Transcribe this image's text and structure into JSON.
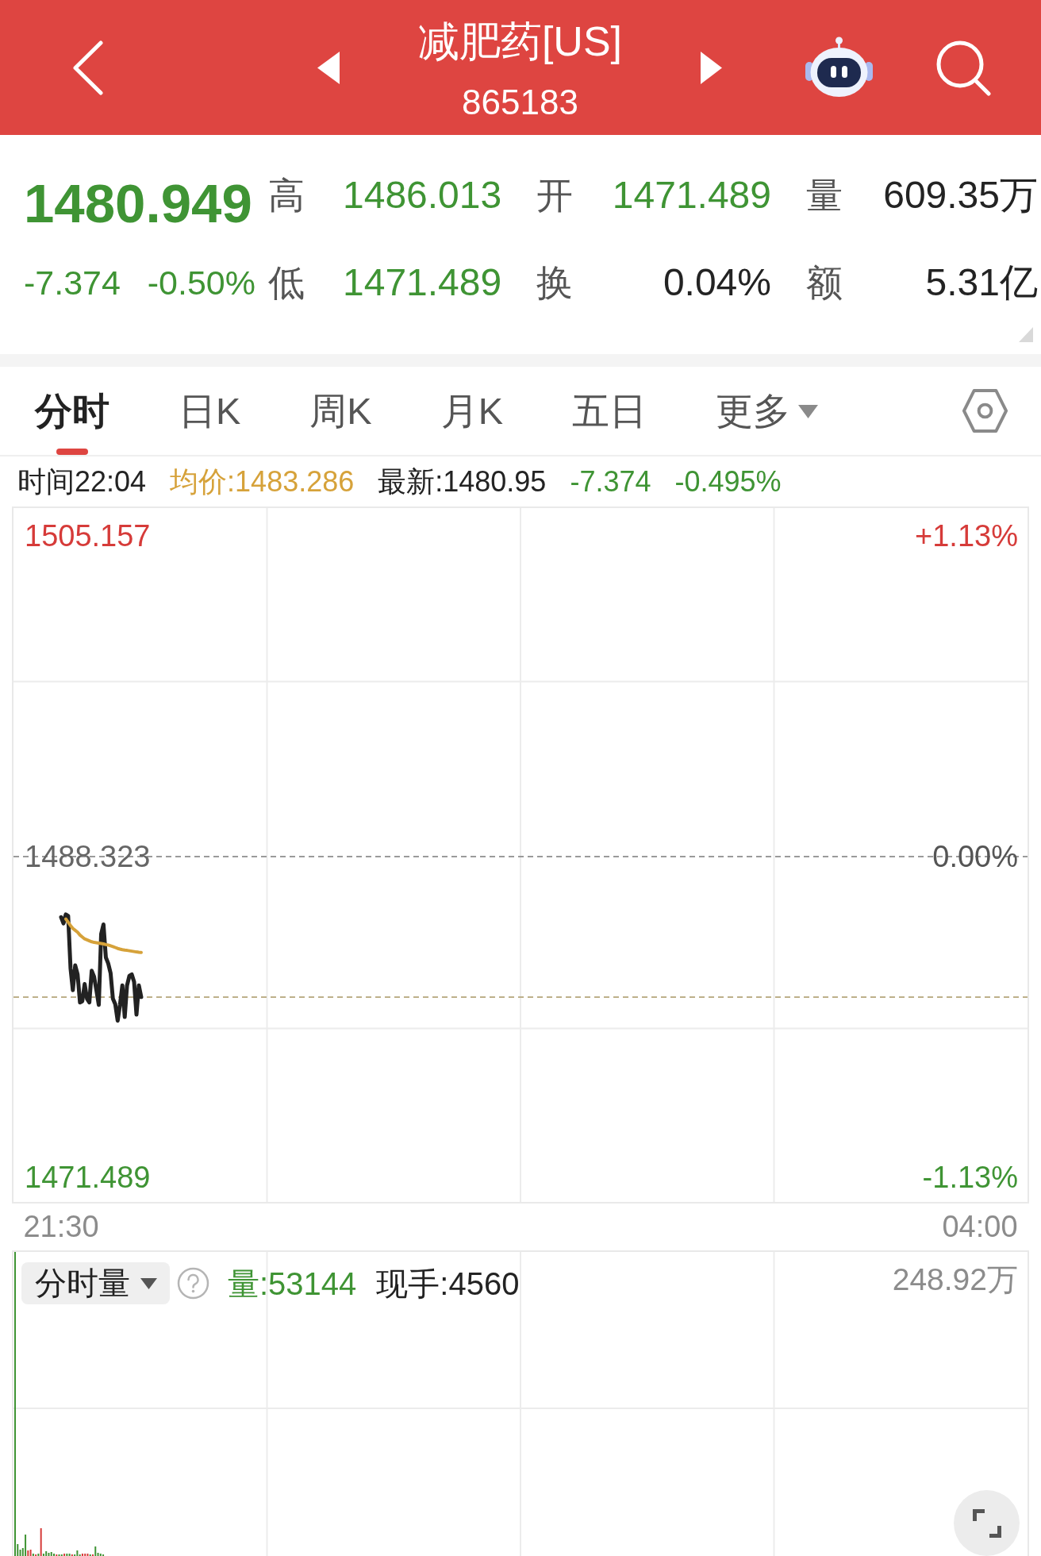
{
  "header": {
    "title": "减肥药[US]",
    "code": "865183"
  },
  "quote": {
    "price": "1480.949",
    "change": "-7.374",
    "change_percent": "-0.50%",
    "color": "#3f9434",
    "stats": [
      {
        "label": "高",
        "value": "1486.013",
        "color": "#3f9434"
      },
      {
        "label": "开",
        "value": "1471.489",
        "color": "#3f9434"
      },
      {
        "label": "量",
        "value": "609.35万",
        "color": "#232323"
      },
      {
        "label": "低",
        "value": "1471.489",
        "color": "#3f9434"
      },
      {
        "label": "换",
        "value": "0.04%",
        "color": "#232323"
      },
      {
        "label": "额",
        "value": "5.31亿",
        "color": "#232323"
      }
    ]
  },
  "tabs": [
    {
      "label": "分时",
      "selected": true,
      "kind": "tab"
    },
    {
      "label": "日K",
      "selected": false,
      "kind": "tab"
    },
    {
      "label": "周K",
      "selected": false,
      "kind": "tab"
    },
    {
      "label": "月K",
      "selected": false,
      "kind": "tab"
    },
    {
      "label": "五日",
      "selected": false,
      "kind": "tab"
    },
    {
      "label": "更多",
      "selected": false,
      "kind": "menu"
    }
  ],
  "info_bar": [
    {
      "text": "时间22:04",
      "color": "#232323"
    },
    {
      "text": "均价:1483.286",
      "color": "#d6a23a"
    },
    {
      "text": "最新:1480.95",
      "color": "#232323"
    },
    {
      "text": "-7.374",
      "color": "#3f9434"
    },
    {
      "text": "-0.495%",
      "color": "#3f9434"
    }
  ],
  "price_chart": {
    "chart_data": {
      "type": "line",
      "categories": [
        "21:30",
        null,
        null,
        null,
        null,
        null,
        null,
        null,
        null,
        null,
        null,
        null,
        null,
        null,
        null,
        null,
        null,
        null,
        null,
        null,
        null,
        null,
        null,
        null,
        null,
        null,
        null,
        null,
        null,
        null,
        null,
        null,
        null,
        null,
        null,
        null,
        null,
        null,
        null,
        null,
        null,
        null,
        null,
        null,
        null,
        null,
        null,
        null,
        null,
        null,
        null,
        null,
        null,
        null,
        null,
        null,
        null,
        null,
        null,
        null,
        null,
        null,
        null,
        null,
        null,
        null,
        null,
        null,
        null,
        null,
        null,
        null,
        null,
        null,
        null,
        null,
        null,
        null,
        null,
        null,
        null,
        null,
        null,
        null,
        null,
        null,
        null,
        null,
        null,
        null,
        null,
        null,
        null,
        null,
        null,
        null,
        null,
        null,
        null,
        null,
        null,
        null,
        null,
        null,
        null,
        null,
        null,
        null,
        null,
        null,
        null,
        null,
        null,
        null,
        null,
        null,
        null,
        null,
        null,
        null,
        null,
        null,
        null,
        null,
        null,
        null,
        null,
        null,
        null,
        null,
        null,
        null,
        null,
        null,
        null,
        null,
        null,
        null,
        null,
        null,
        null,
        null,
        null,
        null,
        null,
        null,
        null,
        null,
        null,
        null,
        null,
        null,
        null,
        null,
        null,
        null,
        null,
        null,
        null,
        null,
        null,
        null,
        null,
        null,
        null,
        null,
        null,
        null,
        null,
        null,
        null,
        null,
        null,
        null,
        null,
        null,
        null,
        null,
        null,
        null,
        null,
        null,
        null,
        null,
        null,
        null,
        null,
        null,
        null,
        null,
        null,
        null,
        null,
        null,
        null,
        null,
        null,
        null,
        null,
        null,
        null,
        null,
        null,
        null,
        null,
        null,
        null,
        null,
        null,
        null,
        null,
        null,
        null,
        null,
        null,
        null,
        null,
        null,
        null,
        null,
        null,
        null,
        null,
        null,
        null,
        null,
        null,
        null,
        null,
        null,
        null,
        null,
        null,
        null,
        null,
        null,
        null,
        null,
        null,
        null,
        null,
        null,
        null,
        null,
        null,
        null,
        null,
        null,
        null,
        null,
        null,
        null,
        null,
        null,
        null,
        null,
        null,
        null,
        null,
        null,
        null,
        null,
        null,
        null,
        null,
        null,
        null,
        null,
        null,
        null,
        null,
        null,
        null,
        null,
        null,
        null,
        null,
        null,
        null,
        null,
        null,
        null,
        null,
        null,
        null,
        null,
        null,
        null,
        null,
        null,
        null,
        null,
        null,
        null,
        null,
        null,
        null,
        null,
        null,
        null,
        null,
        null,
        null,
        null,
        null,
        null,
        null,
        null,
        null,
        null,
        null,
        null,
        null,
        null,
        null,
        null,
        null,
        null,
        null,
        null,
        null,
        null,
        null,
        null,
        null,
        null,
        null,
        null,
        null,
        null,
        null,
        null,
        null,
        null,
        null,
        null,
        null,
        null,
        null,
        null,
        null,
        null,
        null,
        null,
        null,
        null,
        null,
        null,
        null,
        null,
        null,
        null,
        null,
        null,
        null,
        null,
        null,
        null,
        null,
        null,
        null,
        null,
        null,
        null,
        null,
        null,
        null,
        null,
        null,
        null,
        null,
        null,
        null,
        null,
        null,
        null,
        null,
        null,
        null,
        null,
        null,
        null,
        null,
        null,
        null,
        null,
        null,
        null,
        null,
        null,
        "04:00"
      ],
      "ylim": [
        1470.197,
        1506.615
      ],
      "yticks": [
        {
          "value": 1471.489,
          "label": "1471.489"
        },
        {
          "value": 1488.323,
          "label": "1488.323"
        },
        {
          "value": 1505.157,
          "label": "1505.157"
        }
      ],
      "series": [
        {
          "color": "#222222",
          "values": [
            1485.14,
            1484.82,
            1485.29,
            1485.2,
            1482.46,
            1481.31,
            1482.61,
            1482.14,
            1480.67,
            1480.73,
            1481.63,
            1480.86,
            1480.67,
            1482.33,
            1482.01,
            1481.31,
            1480.54,
            1484.25,
            1484.76,
            1483.03,
            1482.71,
            1482.2,
            1480.86,
            1480.57,
            1479.71,
            1480.54,
            1481.56,
            1479.9,
            1481.56,
            1482.07,
            1482.14,
            1481.75,
            1480.03,
            1481.56,
            1480.95,
            null,
            null,
            null,
            null,
            null,
            null,
            null,
            null,
            null,
            null,
            null,
            null,
            null,
            null,
            null,
            null,
            null,
            null,
            null,
            null,
            null,
            null,
            null,
            null,
            null,
            null,
            null,
            null,
            null,
            null,
            null,
            null,
            null,
            null,
            null,
            null,
            null,
            null,
            null,
            null,
            null,
            null,
            null,
            null,
            null,
            null,
            null,
            null,
            null,
            null,
            null,
            null,
            null,
            null,
            null,
            null,
            null,
            null,
            null,
            null,
            null,
            null,
            null,
            null,
            null,
            null,
            null,
            null,
            null,
            null,
            null,
            null,
            null,
            null,
            null,
            null,
            null,
            null,
            null,
            null,
            null,
            null,
            null,
            null,
            null,
            null,
            null,
            null,
            null,
            null,
            null,
            null,
            null,
            null,
            null,
            null,
            null,
            null,
            null,
            null,
            null,
            null,
            null,
            null,
            null,
            null,
            null,
            null,
            null,
            null,
            null,
            null,
            null,
            null,
            null,
            null,
            null,
            null,
            null,
            null,
            null,
            null,
            null,
            null,
            null,
            null,
            null,
            null,
            null,
            null,
            null,
            null,
            null,
            null,
            null,
            null,
            null,
            null,
            null,
            null,
            null,
            null,
            null,
            null,
            null,
            null,
            null,
            null,
            null,
            null,
            null,
            null,
            null,
            null,
            null,
            null,
            null,
            null,
            null,
            null,
            null,
            null,
            null,
            null,
            null,
            null,
            null,
            null,
            null,
            null,
            null,
            null,
            null,
            null,
            null,
            null,
            null,
            null,
            null,
            null,
            null,
            null,
            null,
            null,
            null,
            null,
            null,
            null,
            null,
            null,
            null,
            null,
            null,
            null,
            null,
            null,
            null,
            null,
            null,
            null,
            null,
            null,
            null,
            null,
            null,
            null,
            null,
            null,
            null,
            null,
            null,
            null,
            null,
            null,
            null,
            null,
            null,
            null,
            null,
            null,
            null,
            null,
            null,
            null,
            null,
            null,
            null,
            null,
            null,
            null,
            null,
            null,
            null,
            null,
            null,
            null,
            null,
            null,
            null,
            null,
            null,
            null,
            null,
            null,
            null,
            null,
            null,
            null,
            null,
            null,
            null,
            null,
            null,
            null,
            null,
            null,
            null,
            null,
            null,
            null,
            null,
            null,
            null,
            null,
            null,
            null,
            null,
            null,
            null,
            null,
            null,
            null,
            null,
            null,
            null,
            null,
            null,
            null,
            null,
            null,
            null,
            null,
            null,
            null,
            null,
            null,
            null,
            null,
            null,
            null,
            null,
            null,
            null,
            null,
            null,
            null,
            null,
            null,
            null,
            null,
            null,
            null,
            null,
            null,
            null,
            null,
            null,
            null,
            null,
            null,
            null,
            null,
            null,
            null,
            null,
            null,
            null,
            null,
            null,
            null,
            null,
            null,
            null,
            null,
            null,
            null,
            null,
            null,
            null,
            null,
            null,
            null,
            null,
            null,
            null,
            null,
            null,
            null,
            null,
            null,
            null,
            null,
            null,
            null,
            null,
            null,
            null,
            null,
            null,
            null,
            null,
            null,
            null,
            null,
            null,
            null
          ]
        },
        {
          "color": "#d6a23a",
          "values": [
            null,
            null,
            1485.05,
            1484.88,
            1484.7,
            1484.55,
            1484.45,
            1484.35,
            1484.2,
            1484.1,
            1484.0,
            1483.95,
            1483.9,
            1483.85,
            1483.82,
            1483.8,
            1483.78,
            1483.76,
            1483.74,
            1483.7,
            1483.68,
            1483.64,
            1483.6,
            1483.55,
            1483.5,
            1483.47,
            1483.44,
            1483.42,
            1483.4,
            1483.38,
            1483.36,
            1483.34,
            1483.32,
            1483.3,
            1483.29,
            null,
            null,
            null,
            null,
            null,
            null,
            null,
            null,
            null,
            null,
            null,
            null,
            null,
            null,
            null,
            null,
            null,
            null,
            null,
            null,
            null,
            null,
            null,
            null,
            null,
            null,
            null,
            null,
            null,
            null,
            null,
            null,
            null,
            null,
            null,
            null,
            null,
            null,
            null,
            null,
            null,
            null,
            null,
            null,
            null,
            null,
            null,
            null,
            null,
            null,
            null,
            null,
            null,
            null,
            null,
            null,
            null,
            null,
            null,
            null,
            null,
            null,
            null,
            null,
            null,
            null,
            null,
            null,
            null,
            null,
            null,
            null,
            null,
            null,
            null,
            null,
            null,
            null,
            null,
            null,
            null,
            null,
            null,
            null,
            null,
            null,
            null,
            null,
            null,
            null,
            null,
            null,
            null,
            null,
            null,
            null,
            null,
            null,
            null,
            null,
            null,
            null,
            null,
            null,
            null,
            null,
            null,
            null,
            null,
            null,
            null,
            null,
            null,
            null,
            null,
            null,
            null,
            null,
            null,
            null,
            null,
            null,
            null,
            null,
            null,
            null,
            null,
            null,
            null,
            null,
            null,
            null,
            null,
            null,
            null,
            null,
            null,
            null,
            null,
            null,
            null,
            null,
            null,
            null,
            null,
            null,
            null,
            null,
            null,
            null,
            null,
            null,
            null,
            null,
            null,
            null,
            null,
            null,
            null,
            null,
            null,
            null,
            null,
            null,
            null,
            null,
            null,
            null,
            null,
            null,
            null,
            null,
            null,
            null,
            null,
            null,
            null,
            null,
            null,
            null,
            null,
            null,
            null,
            null,
            null,
            null,
            null,
            null,
            null,
            null,
            null,
            null,
            null,
            null,
            null,
            null,
            null,
            null,
            null,
            null,
            null,
            null,
            null,
            null,
            null,
            null,
            null,
            null,
            null,
            null,
            null,
            null,
            null,
            null,
            null,
            null,
            null,
            null,
            null,
            null,
            null,
            null,
            null,
            null,
            null,
            null,
            null,
            null,
            null,
            null,
            null,
            null,
            null,
            null,
            null,
            null,
            null,
            null,
            null,
            null,
            null,
            null,
            null,
            null,
            null,
            null,
            null,
            null,
            null,
            null,
            null,
            null,
            null,
            null,
            null,
            null,
            null,
            null,
            null,
            null,
            null,
            null,
            null,
            null,
            null,
            null,
            null,
            null,
            null,
            null,
            null,
            null,
            null,
            null,
            null,
            null,
            null,
            null,
            null,
            null,
            null,
            null,
            null,
            null,
            null,
            null,
            null,
            null,
            null,
            null,
            null,
            null,
            null,
            null,
            null,
            null,
            null,
            null,
            null,
            null,
            null,
            null,
            null,
            null,
            null,
            null,
            null,
            null,
            null,
            null,
            null,
            null,
            null,
            null,
            null,
            null,
            null,
            null,
            null,
            null,
            null,
            null,
            null,
            null,
            null,
            null,
            null,
            null,
            null,
            null,
            null,
            null,
            null,
            null,
            null,
            null,
            null,
            null,
            null,
            null,
            null,
            null,
            null,
            null,
            null,
            null,
            null,
            null,
            null,
            null,
            null,
            null,
            null,
            null,
            null,
            null
          ]
        }
      ],
      "ref_lines": [
        {
          "axis": "y",
          "value": 1488.323,
          "color": "#9a9a9a"
        },
        {
          "axis": "y",
          "value": 1480.949,
          "color": "#bdb08a"
        }
      ]
    },
    "percent_labels": [
      {
        "text": "+1.13%",
        "color": "#d63b39"
      },
      {
        "text": "0.00%",
        "color": "#555555"
      },
      {
        "text": "-1.13%",
        "color": "#3f9434"
      }
    ]
  },
  "volume_chart": {
    "indicator": "分时量",
    "volume": "量:53144",
    "last_volume": "现手:4560",
    "max_label": "248.92万"
  }
}
